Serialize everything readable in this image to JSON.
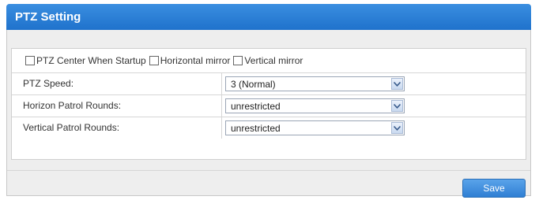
{
  "panel": {
    "title": "PTZ Setting"
  },
  "options": [
    {
      "label": "PTZ Center When Startup",
      "checked": false
    },
    {
      "label": "Horizontal mirror",
      "checked": false
    },
    {
      "label": "Vertical mirror",
      "checked": false
    }
  ],
  "settings": [
    {
      "label": "PTZ Speed:",
      "value": "3 (Normal)"
    },
    {
      "label": "Horizon Patrol Rounds:",
      "value": "unrestricted"
    },
    {
      "label": "Vertical Patrol Rounds:",
      "value": "unrestricted"
    }
  ],
  "actions": {
    "save_label": "Save"
  },
  "colors": {
    "header": "#1f72cc",
    "button": "#2f7fd4"
  }
}
